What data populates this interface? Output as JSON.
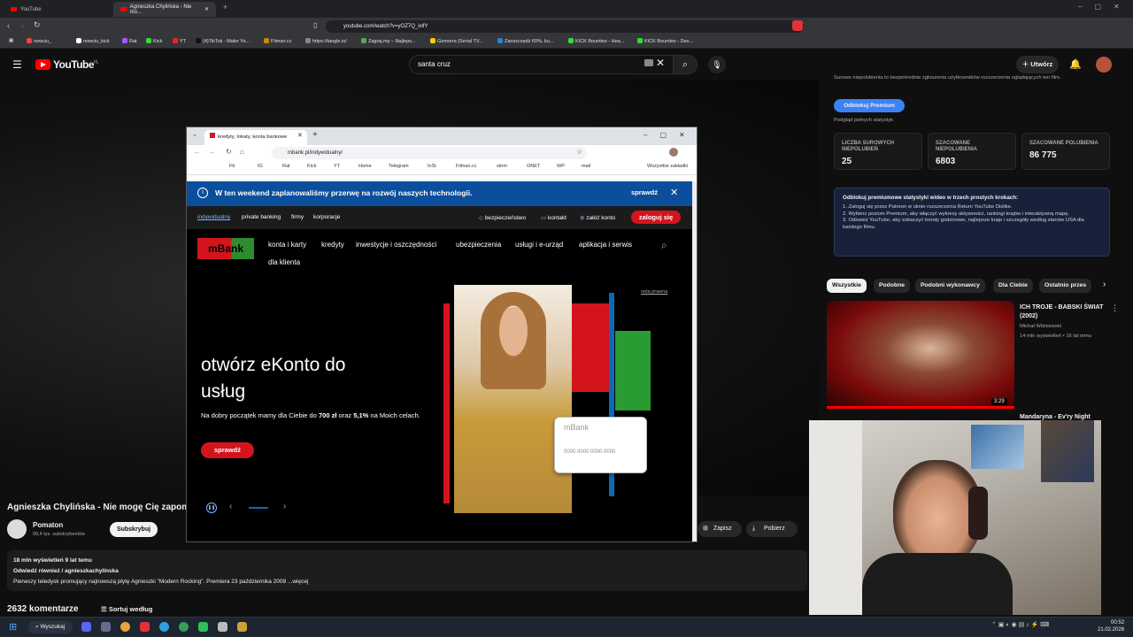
{
  "browser": {
    "tabs": [
      {
        "label": "YouTube"
      },
      {
        "label": "Agnieszka Chylińska - Nie mo..."
      }
    ],
    "url": "youtube.com/watch?v=yOZ7Q_ixlfY",
    "bookmarks": [
      "nowciu_",
      "nowciu_kick",
      "Rat",
      "Kick",
      "YT",
      "(4)TikTok - Make Yo...",
      "Filman.cc",
      "https://tangle.io/",
      "Zagraj.my – Najleps...",
      "Gomorra (Serial TV...",
      "Zaoszczędź 60%, ku...",
      "KICK Bounties - Hea...",
      "KICK Bounties - Des..."
    ]
  },
  "youtube": {
    "logo": "YouTube",
    "logo_region": "PL",
    "search_value": "santa cruz",
    "create_label": "Utwórz",
    "video_title": "Agnieszka Chylińska - Nie mogę Cię zapomnieć",
    "channel_name": "Pomaton",
    "subscribers": "99,4 tys. subskrybentów",
    "subscribe_label": "Subskrybuj",
    "save_label": "Zapisz",
    "download_label": "Pobierz",
    "views_line": "18 mln wyświetleń  9 lat temu",
    "visit_line": "Odwiedź również  / agnieszkachylinska",
    "description": "Pierwszy teledysk promujący najnowszą płytę Agnieszki \"Modern Rocking\". Premiera 23 października 2009 ...więcej",
    "comments_count": "2632 komentarze",
    "sort_label": "Sortuj według"
  },
  "sidebar": {
    "top_text": "Surowe niepolubienia to bezpośrednie zgłoszenia użytkowników rozszerzenia oglądających ten film.",
    "unlock_label": "Odblokuj Premium",
    "preview_label": "Podgląd pełnych statystyk",
    "stats": [
      {
        "label": "LICZBA SUROWYCH NIEPOLUBIEŃ",
        "value": "25"
      },
      {
        "label": "SZACOWANE NIEPOLUBIENIA",
        "value": "6803"
      },
      {
        "label": "SZACOWANE POLUBIENIA",
        "value": "86 775"
      }
    ],
    "premium_title": "Odblokuj premiumowe statystyki wideo w trzech prostych krokach:",
    "premium_steps": [
      "1. Zaloguj się przez Patreon w oknie rozszerzenia Return YouTube Dislike.",
      "2. Wybierz poziom Premium, aby włączyć wykresy aktywności, rankingi krajów i interaktywną mapę.",
      "3. Odśwież YouTube, aby zobaczyć trendy godzinowe, najlepsze kraje i szczegóły według stanów USA dla każdego filmu."
    ],
    "chips": [
      "Wszystkie",
      "Podobne",
      "Podobni wykonawcy",
      "Dla Ciebie",
      "Ostatnio przes"
    ],
    "rec": {
      "title": "ICH TROJE - BABSKI ŚWIAT (2002)",
      "channel": "Michał Wiśniewski",
      "meta": "14 mln wyświetleń • 16 lat temu",
      "duration": "3:29"
    },
    "rec2_title": "Mandaryna - Ev'ry Night"
  },
  "popup": {
    "tab_label": "kredyty, lokaty, konta bankowe",
    "url": "mbank.pl/indywidualny/",
    "bookmarks": [
      "Fb",
      "IG",
      "Rat",
      "Kick",
      "YT",
      "Home",
      "InSt",
      "Telegram",
      "Filman.cc",
      "strim",
      "ONET",
      "WP",
      "mail",
      "Wszystkie zakładki"
    ],
    "banner_text": "W ten weekend zaplanowaliśmy przerwę na rozwój naszych technologii.",
    "banner_link": "sprawdź",
    "segments": [
      "indywidualny",
      "private banking",
      "firmy",
      "korporacje"
    ],
    "top_links": [
      "bezpieczeństwo",
      "kontakt",
      "załóż konto"
    ],
    "login_label": "zaloguj się",
    "logo_text": "mBank",
    "menu": [
      "konta i karty",
      "kredyty",
      "inwestycje i oszczędności",
      "ubezpieczenia",
      "usługi i e-urząd",
      "aplikacja i serwis",
      "dla klienta"
    ],
    "legal_note": "nota prawna",
    "hero_title_1": "otwórz eKonto do",
    "hero_title_2": "usług",
    "hero_text_1": "Na dobry początek mamy dla Ciebie do",
    "hero_bold_1": "700 zł",
    "hero_text_2": "oraz",
    "hero_bold_2": "5,1%",
    "hero_text_3": "na Moich celach.",
    "hero_cta": "sprawdź",
    "card_number": "0000 0000 0000 0000"
  },
  "taskbar": {
    "search_label": "Wyszukaj",
    "time": "00:52",
    "date": "21.02.2026"
  },
  "colors": {
    "yt_red": "#ff0000",
    "mbank_red": "#d4141c",
    "banner_blue": "#0b4e9c",
    "premium_blue": "#3b82f6"
  }
}
